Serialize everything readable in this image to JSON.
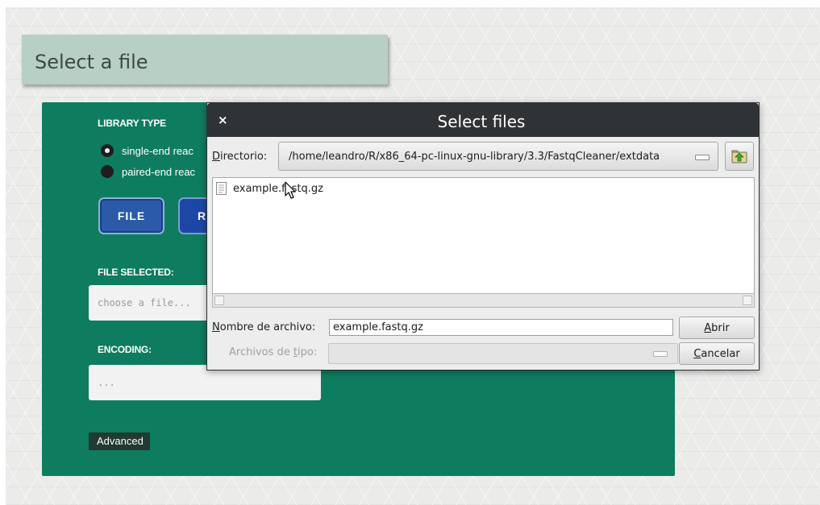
{
  "page": {
    "title": "Select a file"
  },
  "panel": {
    "library_type_label": "LIBRARY TYPE",
    "radio_single": "single-end reac",
    "radio_paired": "paired-end reac",
    "file_button": "FILE",
    "r_button": "R",
    "file_selected_label": "FILE SELECTED:",
    "file_input_placeholder": "choose a file...",
    "encoding_label": "ENCODING:",
    "encoding_placeholder": "...",
    "advanced_button": "Advanced"
  },
  "dialog": {
    "close": "×",
    "title": "Select files",
    "directory_label_accel": "D",
    "directory_label_rest": "irectorio:",
    "directory_path": "/home/leandro/R/x86_64-pc-linux-gnu-library/3.3/FastqCleaner/extdata",
    "files": [
      {
        "name": "example.fastq.gz"
      }
    ],
    "filename_label_accel": "N",
    "filename_label_rest": "ombre de archivo:",
    "filename_value": "example.fastq.gz",
    "filetype_label_pre": "Archivos de ",
    "filetype_label_accel": "t",
    "filetype_label_post": "ipo:",
    "open_button_accel": "A",
    "open_button_rest": "brir",
    "cancel_button_accel": "C",
    "cancel_button_rest": "ancelar"
  },
  "colors": {
    "panel": "#0e7c5f",
    "title_box": "#b7cfc4",
    "dialog_titlebar": "#2f3335",
    "file_button": "#2a5aa8"
  },
  "icons": {
    "close": "close-icon",
    "parent_dir": "folder-up-icon",
    "file": "document-icon",
    "cursor": "mouse-pointer-icon"
  }
}
